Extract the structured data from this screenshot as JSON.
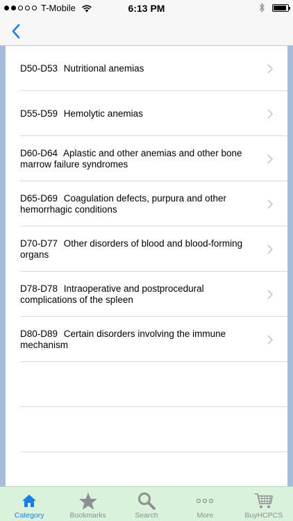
{
  "status_bar": {
    "carrier": "T-Mobile",
    "time": "6:13 PM",
    "signal_bars": 2,
    "signal_total": 5,
    "battery_level": 0.9
  },
  "nav": {
    "back_icon": "chevron-left-icon",
    "accent_color": "#1a7ee3"
  },
  "list": {
    "items": [
      {
        "code": "D50-D53",
        "title": "Nutritional anemias"
      },
      {
        "code": "D55-D59",
        "title": "Hemolytic anemias"
      },
      {
        "code": "D60-D64",
        "title": "Aplastic and other anemias and other bone marrow failure syndromes"
      },
      {
        "code": "D65-D69",
        "title": "Coagulation defects, purpura and other hemorrhagic conditions"
      },
      {
        "code": "D70-D77",
        "title": "Other disorders of blood and blood-forming organs"
      },
      {
        "code": "D78-D78",
        "title": "Intraoperative and postprocedural complications of the spleen"
      },
      {
        "code": "D80-D89",
        "title": "Certain disorders involving the immune mechanism"
      }
    ]
  },
  "tabs": [
    {
      "label": "Category",
      "icon": "house-icon",
      "active": true
    },
    {
      "label": "Bookmarks",
      "icon": "star-icon",
      "active": false
    },
    {
      "label": "Search",
      "icon": "magnifier-icon",
      "active": false
    },
    {
      "label": "More",
      "icon": "ellipsis-icon",
      "active": false
    },
    {
      "label": "BuyHCPCS",
      "icon": "cart-icon",
      "active": false
    }
  ]
}
